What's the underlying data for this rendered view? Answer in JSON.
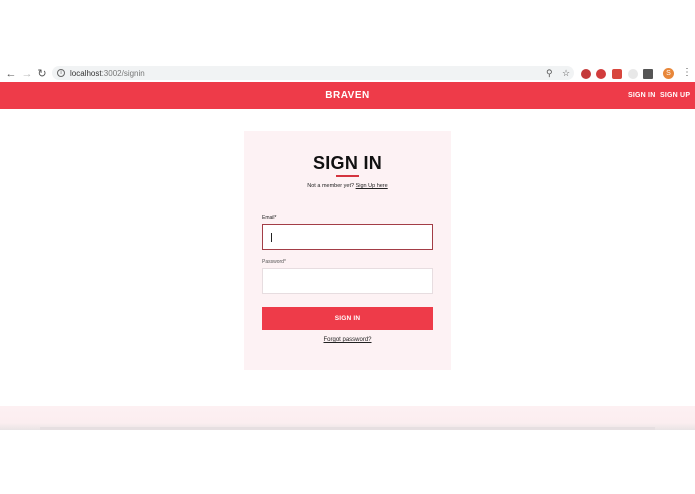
{
  "browser": {
    "url_host": "localhost",
    "url_path": ":3002/signin",
    "back_icon": "arrow-left-icon",
    "forward_icon": "arrow-right-icon",
    "reload_icon": "reload-icon",
    "profile_initial": "S"
  },
  "header": {
    "brand": "BRAVEN",
    "signin_link": "SIGN IN",
    "signup_link": "SIGN UP",
    "color": "#ee3b49"
  },
  "signin": {
    "title": "SIGN IN",
    "member_prompt": "Not a member yet?",
    "signup_link": "Sign Up here",
    "email_label": "Email*",
    "email_value": "",
    "password_label": "Password*",
    "password_value": "",
    "submit_label": "SIGN IN",
    "forgot_link": "Forgot password?"
  }
}
